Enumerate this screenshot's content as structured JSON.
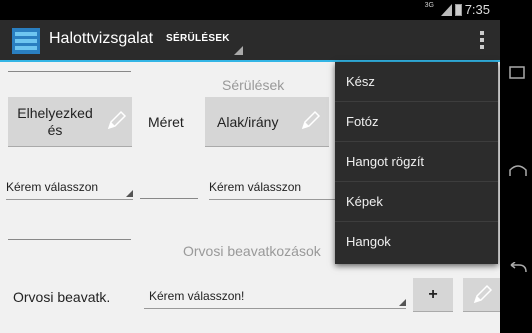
{
  "status_bar": {
    "signal_label": "3G",
    "time": "7:35"
  },
  "action_bar": {
    "title": "Halottvizsgalat",
    "tab_spinner": "SÉRÜLÉSEK"
  },
  "injuries": {
    "section_title": "Sérülések",
    "location_button": "Elhelyezked\nés",
    "size_label": "Méret",
    "shape_button": "Alak/irány",
    "location_spinner": "Kérem válasszon",
    "shape_spinner": "Kérem válasszon"
  },
  "medical": {
    "section_title": "Orvosi beavatkozások",
    "row_label": "Orvosi beavatk.",
    "spinner": "Kérem válasszon!",
    "add_button": "+"
  },
  "menu": {
    "items": [
      "Kész",
      "Fotóz",
      "Hangot rögzít",
      "Képek",
      "Hangok"
    ]
  },
  "colors": {
    "accent": "#33b5e5",
    "menu_bg": "#2c2c2c",
    "button_bg": "#d6d6d6"
  }
}
